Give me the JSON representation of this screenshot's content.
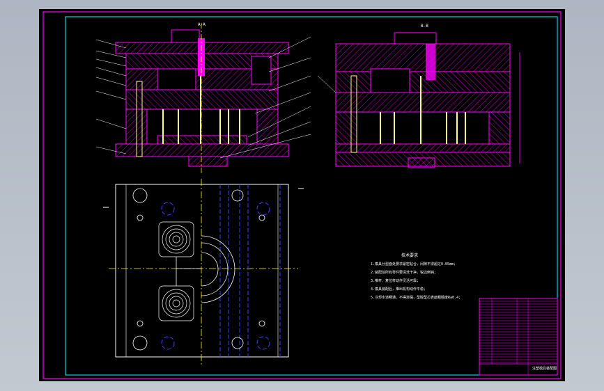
{
  "drawing": {
    "section_labels": {
      "left": "A-A",
      "right": "B-B"
    },
    "tech_requirements": {
      "title": "技术要求",
      "lines": [
        "1.模具分型面处要求紧密贴合，间隙不得超过0.05mm；",
        "2.装配前所有零件要清洗干净，锐边倒钝；",
        "3.推杆、复位杆动作灵活可靠；",
        "4.模具装配后，推出机构动作平稳；",
        "5.冷却水道畅通，不得渗漏，型腔型芯表面粗糙度Ra0.4；"
      ]
    },
    "title_block": {
      "drawing_title": "注塑模具装配图"
    }
  },
  "colors": {
    "sheet_bg": "#000000",
    "frame": "#ff00ff",
    "inner_frame": "#00ffff",
    "part": "#ff00ff",
    "hatch": "#b000b0",
    "pins": "#ffff80",
    "centerline": "#ffff00",
    "hidden": "#4040ff",
    "text": "#ffffff",
    "title_block": "#ff00ff"
  }
}
